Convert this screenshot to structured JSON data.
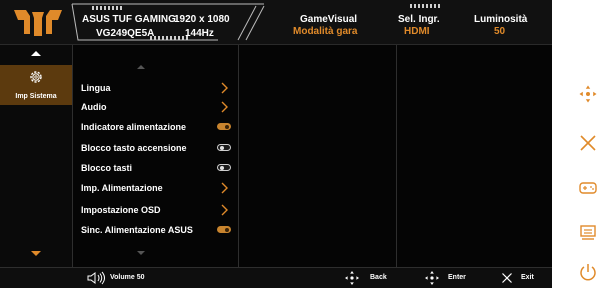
{
  "header": {
    "brand": "ASUS TUF GAMING",
    "model": "VG249QE5A",
    "resolution": "1920 x 1080",
    "refresh": "144Hz",
    "game_visual_label": "GameVisual",
    "game_visual_value": "Modalità gara",
    "input_label": "Sel. Ingr.",
    "input_value": "HDMI",
    "brightness_label": "Luminosità",
    "brightness_value": "50"
  },
  "category": {
    "label": "Imp Sistema",
    "icon": "gear-icon"
  },
  "menu": {
    "items": [
      {
        "label": "Lingua",
        "control": "chevron"
      },
      {
        "label": "Audio",
        "control": "chevron"
      },
      {
        "label": "Indicatore alimentazione",
        "control": "toggle-on"
      },
      {
        "label": "Blocco tasto accensione",
        "control": "toggle-off"
      },
      {
        "label": "Blocco tasti",
        "control": "toggle-off"
      },
      {
        "label": "Imp. Alimentazione",
        "control": "chevron"
      },
      {
        "label": "Impostazione OSD",
        "control": "chevron"
      },
      {
        "label": "Sinc. Alimentazione ASUS",
        "control": "toggle-on"
      }
    ]
  },
  "footer": {
    "volume_label": "Volume 50",
    "back_label": "Back",
    "enter_label": "Enter",
    "exit_label": "Exit"
  },
  "side_buttons": [
    "five-way-joystick-icon",
    "close-icon",
    "gamepad-icon",
    "input-icon",
    "power-icon"
  ],
  "colors": {
    "accent": "#e08a2a",
    "selected": "#5c3a0e",
    "background": "#050505"
  }
}
